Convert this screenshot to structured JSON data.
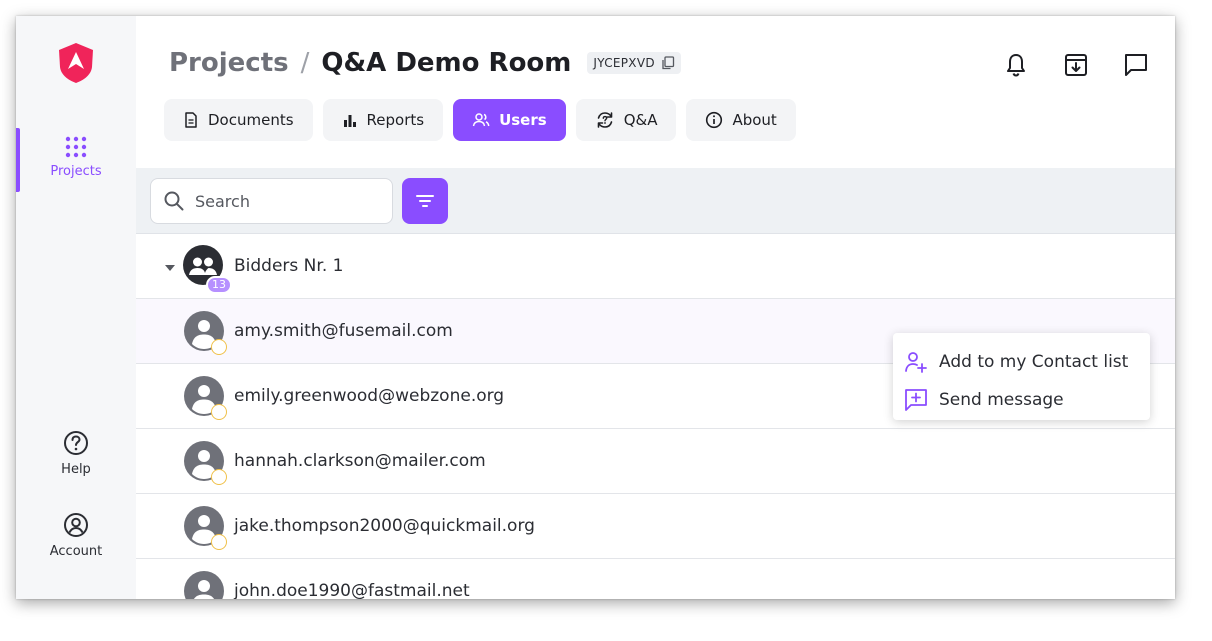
{
  "colors": {
    "accent": "#8a4dff",
    "logo": "#f0245a",
    "status": "#f0c14a",
    "badge": "#b690ff"
  },
  "sidebar": {
    "logo": "shield-logo",
    "items": [
      {
        "label": "Projects",
        "icon": "grid-dots-icon",
        "active": true
      },
      {
        "label": "Help",
        "icon": "help-circle-icon"
      },
      {
        "label": "Account",
        "icon": "account-circle-icon"
      }
    ]
  },
  "header": {
    "breadcrumb": {
      "parent": "Projects",
      "separator": "/",
      "current": "Q&A Demo Room"
    },
    "room_code": "JYCEPXVD",
    "icons": [
      "bell-icon",
      "archive-download-icon",
      "chat-icon"
    ]
  },
  "tabs": [
    {
      "label": "Documents",
      "icon": "document-icon"
    },
    {
      "label": "Reports",
      "icon": "bar-chart-icon"
    },
    {
      "label": "Users",
      "icon": "users-icon",
      "active": true
    },
    {
      "label": "Q&A",
      "icon": "refresh-question-icon"
    },
    {
      "label": "About",
      "icon": "info-icon"
    }
  ],
  "toolbar": {
    "search_placeholder": "Search"
  },
  "group": {
    "name": "Bidders Nr. 1",
    "member_count": "13"
  },
  "users": [
    "amy.smith@fusemail.com",
    "emily.greenwood@webzone.org",
    "hannah.clarkson@mailer.com",
    "jake.thompson2000@quickmail.org",
    "john.doe1990@fastmail.net"
  ],
  "context_menu": {
    "items": [
      {
        "label": "Add to my Contact list",
        "icon": "add-contact-icon"
      },
      {
        "label": "Send message",
        "icon": "message-plus-icon"
      }
    ]
  }
}
